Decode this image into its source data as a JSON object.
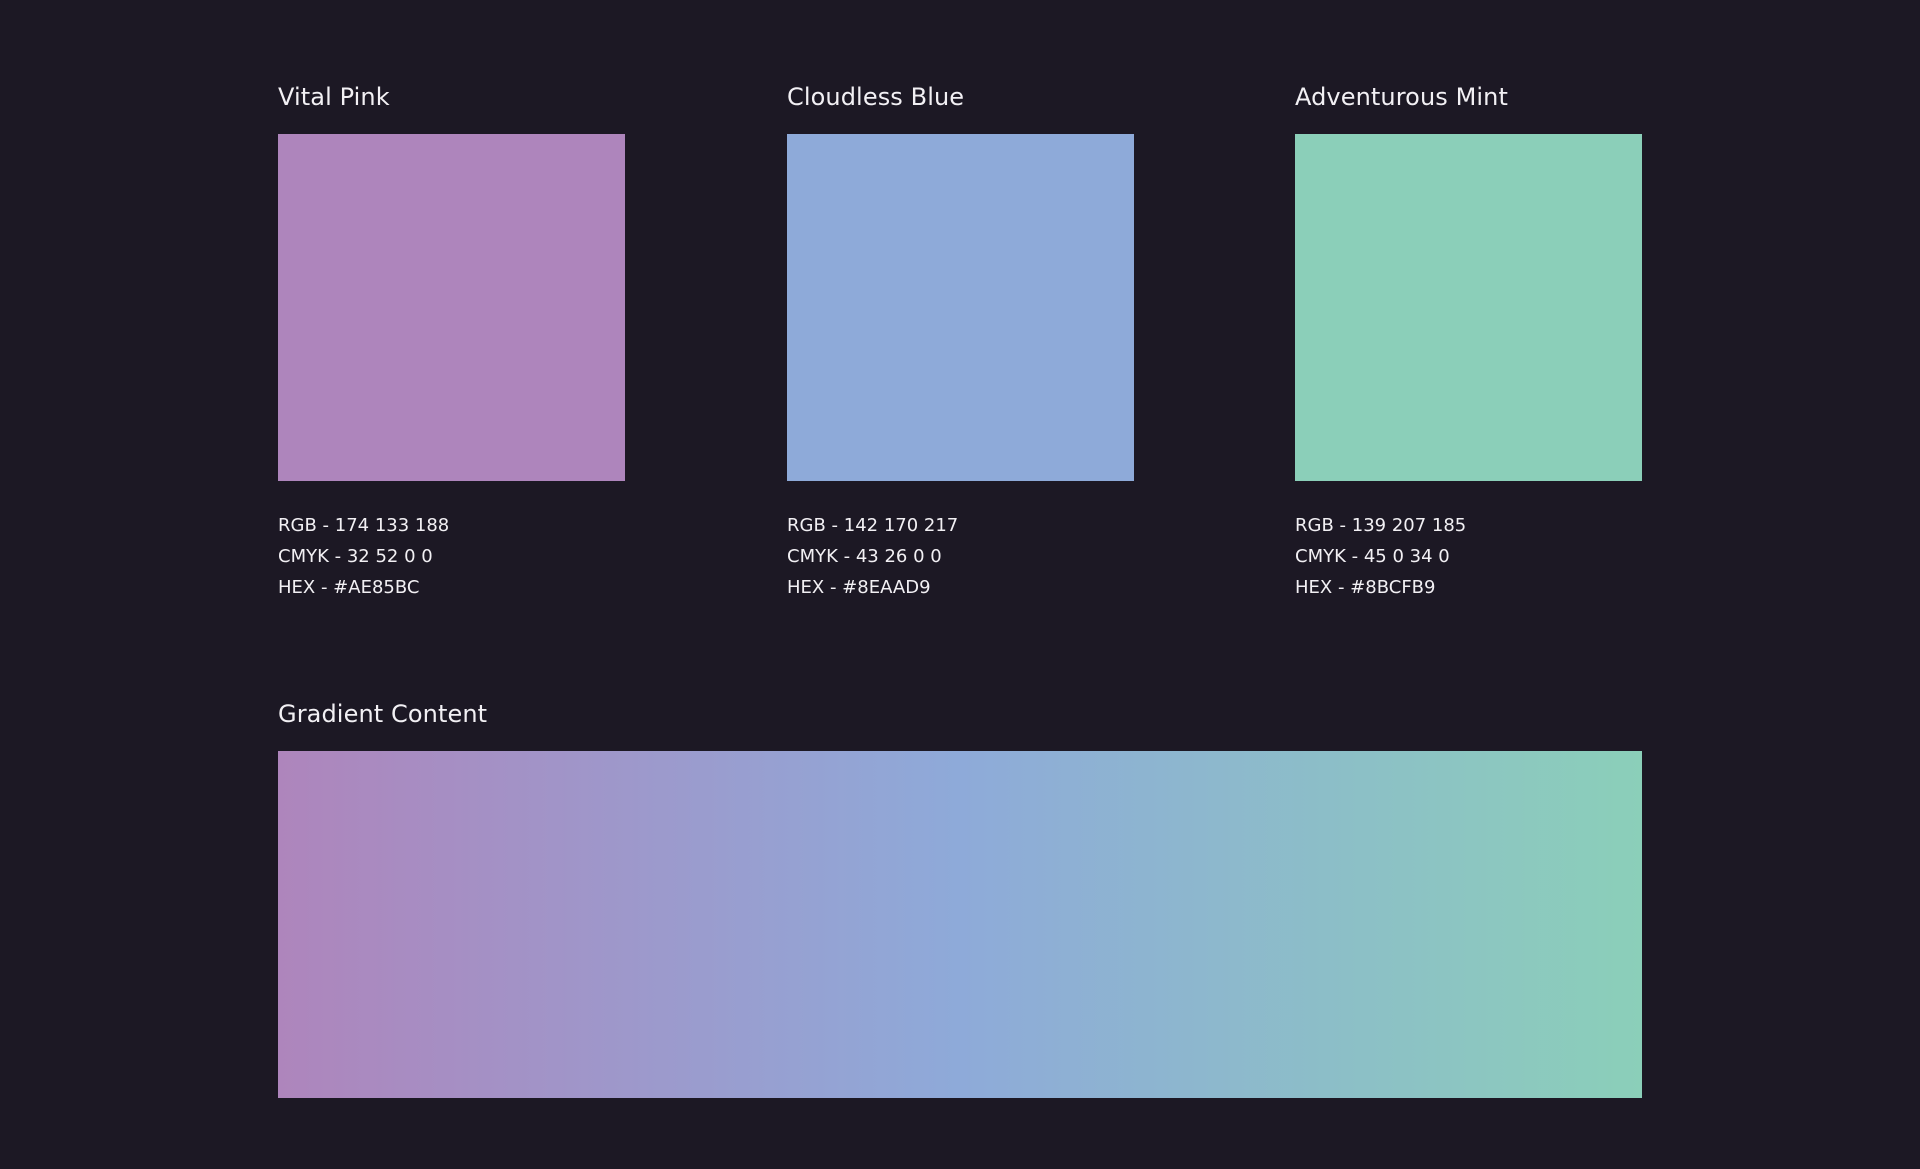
{
  "swatches": [
    {
      "name": "Vital Pink",
      "color": "#AE85BC",
      "rgb": "RGB - 174 133 188",
      "cmyk": "CMYK - 32 52 0 0",
      "hex": "HEX - #AE85BC"
    },
    {
      "name": "Cloudless Blue",
      "color": "#8EAAD9",
      "rgb": "RGB - 142 170 217",
      "cmyk": "CMYK - 43 26 0 0",
      "hex": "HEX - #8EAAD9"
    },
    {
      "name": "Adventurous Mint",
      "color": "#8BCFB9",
      "rgb": "RGB - 139 207 185",
      "cmyk": "CMYK - 45 0 34 0",
      "hex": "HEX - #8BCFB9"
    }
  ],
  "gradient": {
    "title": "Gradient Content",
    "colors": [
      "#AE85BC",
      "#8EAAD9",
      "#8BCFB9"
    ]
  },
  "theme": {
    "background": "#1c1824",
    "text": "#f2f0f4"
  }
}
